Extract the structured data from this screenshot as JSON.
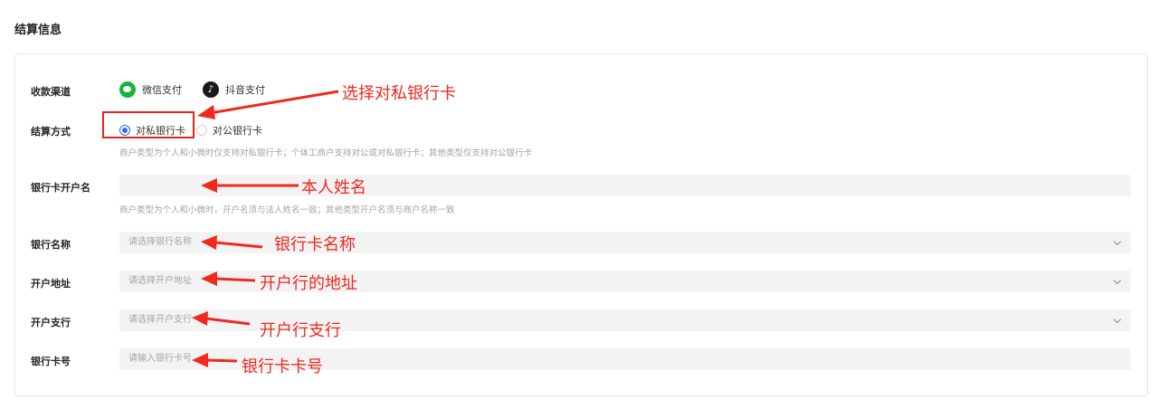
{
  "section_title": "结算信息",
  "channel": {
    "label": "收款渠道",
    "options": [
      {
        "label": "微信支付",
        "icon": "wechat-pay-icon"
      },
      {
        "label": "抖音支付",
        "icon": "douyin-icon"
      }
    ]
  },
  "settle_method": {
    "label": "结算方式",
    "options": [
      {
        "label": "对私银行卡",
        "selected": true
      },
      {
        "label": "对公银行卡",
        "selected": false
      }
    ],
    "hint": "商户类型为个人和小微时仅支持对私银行卡；个体工商户支持对公或对私银行卡；其他类型仅支持对公银行卡"
  },
  "account_name": {
    "label": "银行卡开户名",
    "value": "",
    "hint": "商户类型为个人和小微时，开户名须与法人姓名一致；其他类型开户名须与商户名称一致"
  },
  "bank_name": {
    "label": "银行名称",
    "placeholder": "请选择银行名称"
  },
  "bank_address": {
    "label": "开户地址",
    "placeholder": "请选择开户地址"
  },
  "bank_branch": {
    "label": "开户支行",
    "placeholder": "请选择开户支行"
  },
  "card_number": {
    "label": "银行卡号",
    "placeholder": "请输入银行卡号"
  },
  "annotations": {
    "select_private_card": "选择对私银行卡",
    "own_name": "本人姓名",
    "bank_card_name": "银行卡名称",
    "bank_address": "开户行的地址",
    "bank_branch": "开户行支行",
    "card_number": "银行卡卡号"
  },
  "colors": {
    "accent": "#2f6cf6",
    "annotation": "#f0281e",
    "field_bg": "#f3f3f3"
  }
}
